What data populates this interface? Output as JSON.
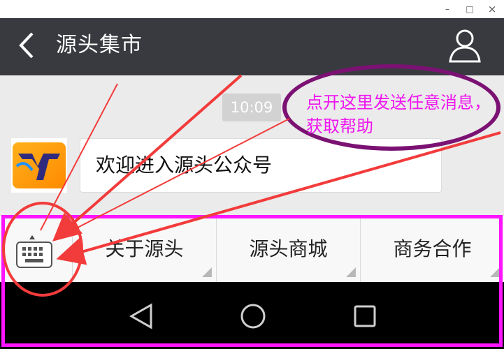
{
  "window": {
    "minimize_glyph": "–",
    "maximize_glyph": "□",
    "close_glyph": "×"
  },
  "header": {
    "back_icon": "chevron-left-icon",
    "back_glyph": "〈",
    "title": "源头集市",
    "profile_icon": "user-profile-icon"
  },
  "chat": {
    "timestamp": "10:09",
    "message": {
      "avatar_logo": "YT",
      "text": "欢迎进入源头公众号"
    }
  },
  "callout": {
    "text": "点开这里发送任意消息，获取帮助",
    "color": "#ef15ef",
    "border_color": "#7b1273"
  },
  "menu": {
    "keyboard_icon": "keyboard-icon",
    "items": [
      {
        "label": "关于源头"
      },
      {
        "label": "源头商城"
      },
      {
        "label": "商务合作"
      }
    ]
  },
  "navbar": {
    "back_icon": "triangle-back-icon",
    "home_icon": "circle-home-icon",
    "recents_icon": "square-recents-icon"
  },
  "annotation": {
    "arrow_color": "#f23b3b",
    "frame_color": "#ff14ff"
  }
}
